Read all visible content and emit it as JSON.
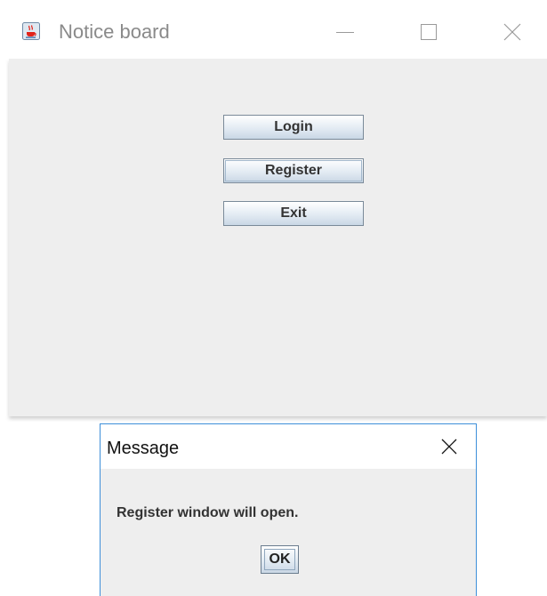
{
  "main_window": {
    "title": "Notice board",
    "app_icon": "java-coffee-icon",
    "controls": {
      "minimize_icon": "minimize-icon",
      "maximize_icon": "maximize-icon",
      "close_icon": "close-icon"
    },
    "buttons": {
      "login_label": "Login",
      "register_label": "Register",
      "exit_label": "Exit"
    }
  },
  "dialog": {
    "title": "Message",
    "close_icon": "close-icon",
    "message": "Register window will open.",
    "ok_label": "OK"
  },
  "colors": {
    "content_background": "#eeeeee",
    "dialog_border": "#3d8fd9",
    "button_border": "#7a8a99"
  }
}
